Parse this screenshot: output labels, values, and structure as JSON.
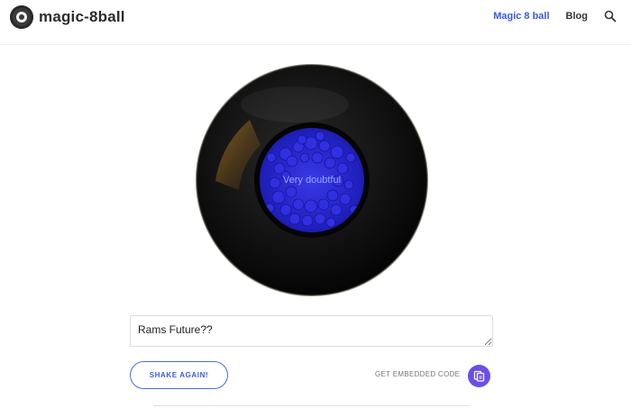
{
  "header": {
    "logo_text": "magic-8ball",
    "nav": [
      {
        "label": "Magic 8 ball",
        "active": true
      },
      {
        "label": "Blog",
        "active": false
      }
    ],
    "search_icon": "search-icon"
  },
  "ball": {
    "answer": "Very doubtful",
    "colors": {
      "shell": "#111111",
      "window": "#2a2ad8",
      "answer_text": "#9aa8ff",
      "highlight": "#a86d1e"
    }
  },
  "question": {
    "value": "Rams Future??"
  },
  "actions": {
    "shake_label": "SHAKE AGAIN!",
    "embed_label": "GET EMBEDDED CODE",
    "embed_icon": "copy-icon"
  },
  "colors": {
    "accent": "#3b5bdb",
    "embed_button": "#6b4ee6"
  }
}
